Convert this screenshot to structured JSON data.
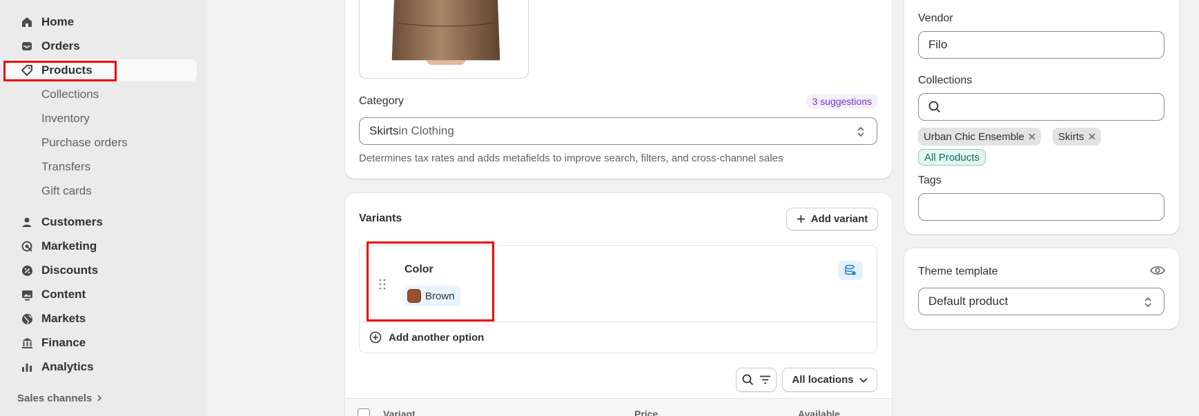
{
  "sidebar": {
    "items": [
      {
        "label": "Home",
        "icon": "home-icon"
      },
      {
        "label": "Orders",
        "icon": "inbox-icon"
      },
      {
        "label": "Products",
        "icon": "tag-icon"
      },
      {
        "label": "Collections"
      },
      {
        "label": "Inventory"
      },
      {
        "label": "Purchase orders"
      },
      {
        "label": "Transfers"
      },
      {
        "label": "Gift cards"
      },
      {
        "label": "Customers",
        "icon": "person-icon"
      },
      {
        "label": "Marketing",
        "icon": "target-icon"
      },
      {
        "label": "Discounts",
        "icon": "discount-icon"
      },
      {
        "label": "Content",
        "icon": "image-icon"
      },
      {
        "label": "Markets",
        "icon": "globe-icon"
      },
      {
        "label": "Finance",
        "icon": "bank-icon"
      },
      {
        "label": "Analytics",
        "icon": "chart-icon"
      }
    ],
    "sales_channels": "Sales channels"
  },
  "category": {
    "label": "Category",
    "suggestions": "3 suggestions",
    "value_main": "Skirts",
    "value_suffix": " in Clothing",
    "help": "Determines tax rates and adds metafields to improve search, filters, and cross-channel sales"
  },
  "variants": {
    "title": "Variants",
    "add_variant": "Add variant",
    "option_name": "Color",
    "option_value": "Brown",
    "swatch_color": "#9a4f2e",
    "add_option": "Add another option",
    "locations": "All locations",
    "columns": [
      "Variant",
      "Price",
      "Available"
    ]
  },
  "organization": {
    "vendor_label": "Vendor",
    "vendor_value": "Filo",
    "collections_label": "Collections",
    "collections": [
      "Urban Chic Ensemble",
      "Skirts"
    ],
    "all_products": "All Products",
    "tags_label": "Tags"
  },
  "theme": {
    "label": "Theme template",
    "value": "Default product"
  }
}
